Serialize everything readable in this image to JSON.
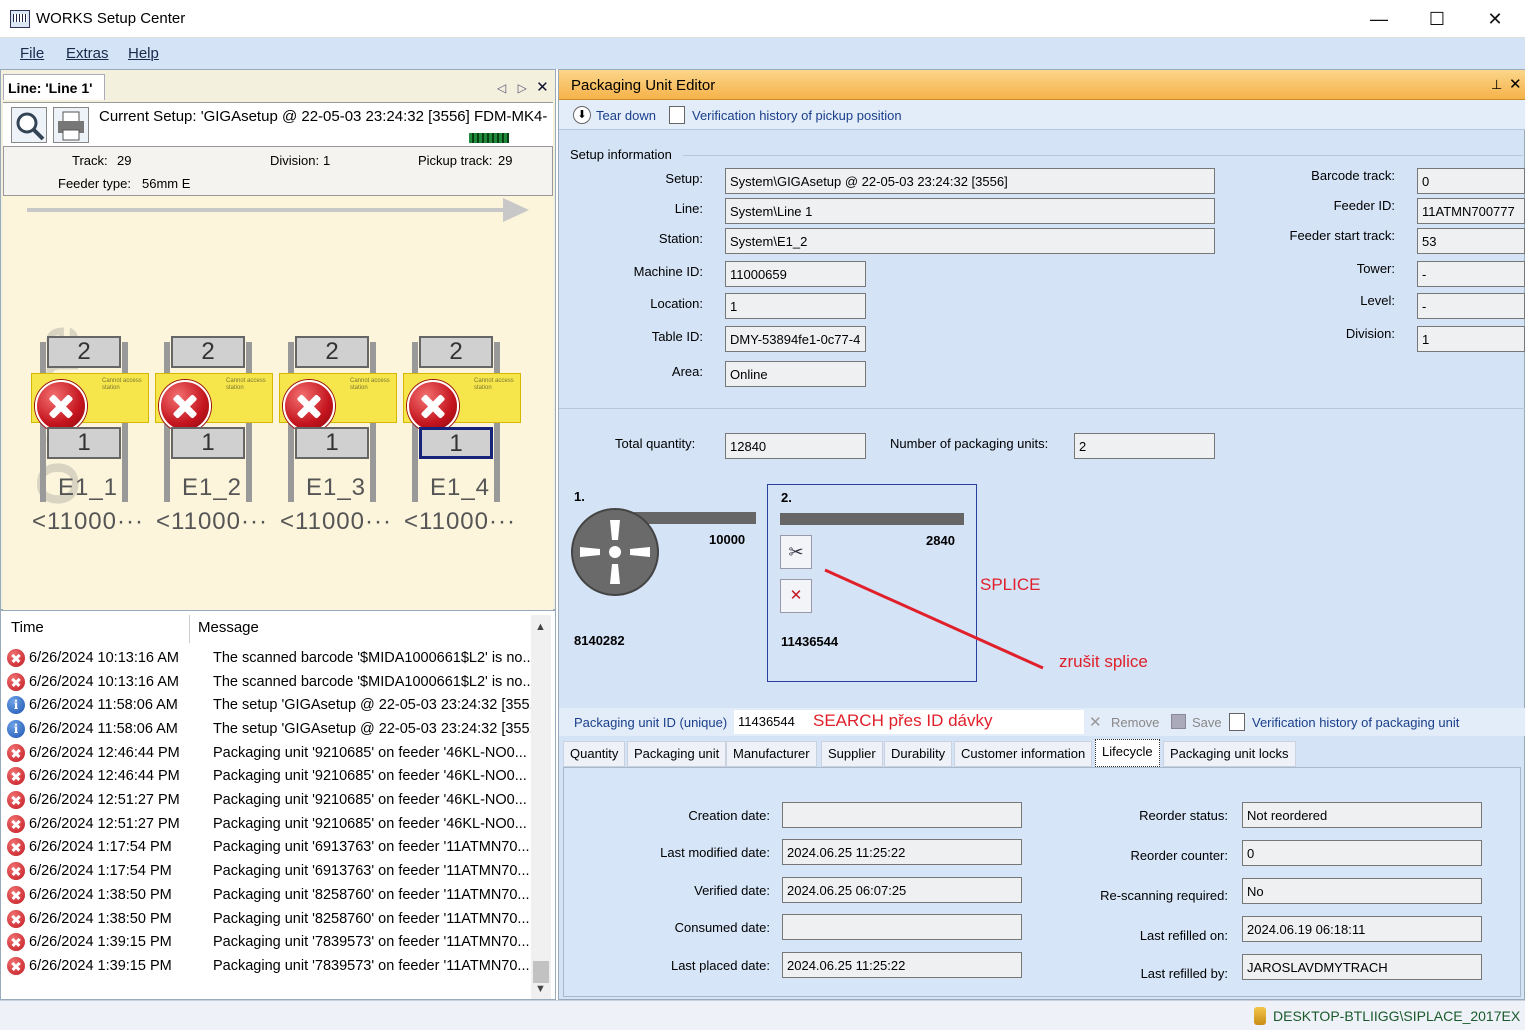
{
  "window": {
    "title": "WORKS Setup Center",
    "minimize": "—",
    "maximize": "☐",
    "close": "✕"
  },
  "menu": [
    "File",
    "Extras",
    "Help"
  ],
  "left": {
    "tab_label": "Line: 'Line 1'",
    "current_setup": "Current Setup: 'GIGAsetup @ 22-05-03 23:24:32 [3556] FDM-MK4-",
    "track_label": "Track:",
    "track_value": "29",
    "division_label": "Division:",
    "division_value": "1",
    "pickup_label": "Pickup track:",
    "pickup_value": "29",
    "feeder_type_label": "Feeder type:",
    "feeder_type_value": "56mm E",
    "feeders": [
      {
        "top": "2",
        "bottom": "1",
        "name": "E1_1",
        "num": "<11000···"
      },
      {
        "top": "2",
        "bottom": "1",
        "name": "E1_2",
        "num": "<11000···"
      },
      {
        "top": "2",
        "bottom": "1",
        "name": "E1_3",
        "num": "<11000···"
      },
      {
        "top": "2",
        "bottom": "1",
        "name": "E1_4",
        "num": "<11000···"
      }
    ],
    "yellow_text": "Cannot access station",
    "watermark": "Online"
  },
  "log": {
    "col_time": "Time",
    "col_message": "Message",
    "rows": [
      {
        "type": "error",
        "time": "6/26/2024 10:13:16 AM",
        "msg": "The scanned barcode '$MIDA1000661$L2' is no..."
      },
      {
        "type": "error",
        "time": "6/26/2024 10:13:16 AM",
        "msg": "The scanned barcode '$MIDA1000661$L2' is no..."
      },
      {
        "type": "info",
        "time": "6/26/2024 11:58:06 AM",
        "msg": "The setup 'GIGAsetup @ 22-05-03 23:24:32 [355..."
      },
      {
        "type": "info",
        "time": "6/26/2024 11:58:06 AM",
        "msg": "The setup 'GIGAsetup @ 22-05-03 23:24:32 [355..."
      },
      {
        "type": "error",
        "time": "6/26/2024 12:46:44 PM",
        "msg": "Packaging unit '9210685' on feeder '46KL-NO0..."
      },
      {
        "type": "error",
        "time": "6/26/2024 12:46:44 PM",
        "msg": "Packaging unit '9210685' on feeder '46KL-NO0..."
      },
      {
        "type": "error",
        "time": "6/26/2024 12:51:27 PM",
        "msg": "Packaging unit '9210685' on feeder '46KL-NO0..."
      },
      {
        "type": "error",
        "time": "6/26/2024 12:51:27 PM",
        "msg": "Packaging unit '9210685' on feeder '46KL-NO0..."
      },
      {
        "type": "error",
        "time": "6/26/2024 1:17:54 PM",
        "msg": "Packaging unit '6913763' on feeder '11ATMN70..."
      },
      {
        "type": "error",
        "time": "6/26/2024 1:17:54 PM",
        "msg": "Packaging unit '6913763' on feeder '11ATMN70..."
      },
      {
        "type": "error",
        "time": "6/26/2024 1:38:50 PM",
        "msg": "Packaging unit '8258760' on feeder '11ATMN70..."
      },
      {
        "type": "error",
        "time": "6/26/2024 1:38:50 PM",
        "msg": "Packaging unit '8258760' on feeder '11ATMN70..."
      },
      {
        "type": "error",
        "time": "6/26/2024 1:39:15 PM",
        "msg": "Packaging unit '7839573' on feeder '11ATMN70..."
      },
      {
        "type": "error",
        "time": "6/26/2024 1:39:15 PM",
        "msg": "Packaging unit '7839573' on feeder '11ATMN70..."
      }
    ]
  },
  "editor": {
    "title": "Packaging Unit Editor",
    "tear_down": "Tear down",
    "verification_pickup": "Verification history of pickup position",
    "setup_info": "Setup information",
    "fields_left": [
      {
        "label": "Setup:",
        "value": "System\\GIGAsetup @ 22-05-03 23:24:32 [3556]"
      },
      {
        "label": "Line:",
        "value": "System\\Line 1"
      },
      {
        "label": "Station:",
        "value": "System\\E1_2"
      },
      {
        "label": "Machine ID:",
        "value": "11000659"
      },
      {
        "label": "Location:",
        "value": "1"
      },
      {
        "label": "Table ID:",
        "value": "DMY-53894fe1-0c77-4"
      },
      {
        "label": "Area:",
        "value": "Online"
      }
    ],
    "fields_right": [
      {
        "label": "Barcode track:",
        "value": "0"
      },
      {
        "label": "Feeder ID:",
        "value": "11ATMN700777"
      },
      {
        "label": "Feeder start track:",
        "value": "53"
      },
      {
        "label": "Tower:",
        "value": "-"
      },
      {
        "label": "Level:",
        "value": "-"
      },
      {
        "label": "Division:",
        "value": "1"
      }
    ],
    "total_qty_label": "Total quantity:",
    "total_qty": "12840",
    "num_units_label": "Number of packaging units:",
    "num_units": "2",
    "unit1": {
      "idx": "1.",
      "qty": "10000",
      "id": "8140282"
    },
    "unit2": {
      "idx": "2.",
      "qty": "2840",
      "id": "11436544"
    },
    "splice_note": "SPLICE",
    "cancel_splice_note": "zrušit splice",
    "pkg_id_label": "Packaging unit ID (unique)",
    "pkg_id_value": "11436544",
    "search_note": "SEARCH přes ID dávky",
    "remove": "Remove",
    "save": "Save",
    "verification_pkg": "Verification history of packaging unit",
    "tabs": [
      "Quantity",
      "Packaging unit",
      "Manufacturer",
      "Supplier",
      "Durability",
      "Customer information",
      "Lifecycle",
      "Packaging unit locks"
    ],
    "active_tab": "Lifecycle",
    "lifecycle_left": [
      {
        "label": "Creation date:",
        "value": ""
      },
      {
        "label": "Last modified date:",
        "value": "2024.06.25 11:25:22"
      },
      {
        "label": "Verified date:",
        "value": "2024.06.25 06:07:25"
      },
      {
        "label": "Consumed date:",
        "value": ""
      },
      {
        "label": "Last placed date:",
        "value": "2024.06.25 11:25:22"
      }
    ],
    "lifecycle_right": [
      {
        "label": "Reorder status:",
        "value": "Not reordered"
      },
      {
        "label": "Reorder counter:",
        "value": "0"
      },
      {
        "label": "Re-scanning required:",
        "value": "No"
      },
      {
        "label": "Last refilled on:",
        "value": "2024.06.19 06:18:11"
      },
      {
        "label": "Last refilled by:",
        "value": "JAROSLAVDMYTRACH"
      }
    ]
  },
  "status": {
    "db": "DESKTOP-BTLIIGG\\SIPLACE_2017EX"
  },
  "colors": {
    "accent_orange": "#f6b24a",
    "annotation_red": "#e0202a",
    "panel_blue": "#d4e3f6"
  }
}
